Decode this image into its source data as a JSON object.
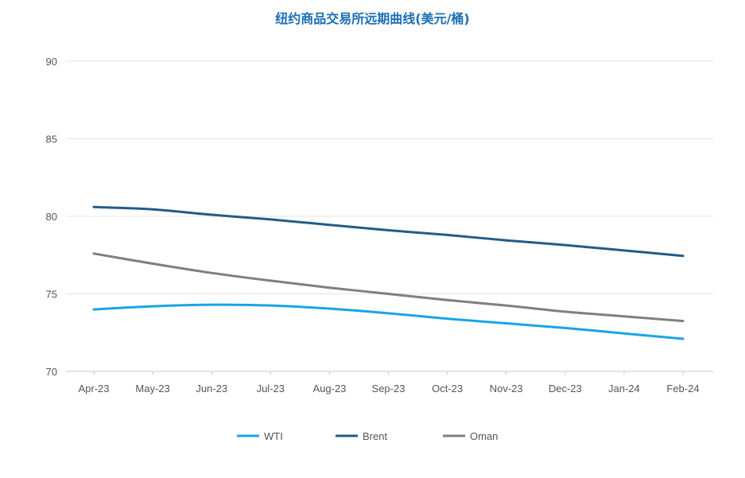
{
  "chart_data": {
    "type": "line",
    "title": "纽约商品交易所远期曲线(美元/桶)",
    "xlabel": "",
    "ylabel": "",
    "categories": [
      "Apr-23",
      "May-23",
      "Jun-23",
      "Jul-23",
      "Aug-23",
      "Sep-23",
      "Oct-23",
      "Nov-23",
      "Dec-23",
      "Jan-24",
      "Feb-24"
    ],
    "ylim": [
      70,
      90
    ],
    "yticks": [
      "70",
      "75",
      "80",
      "85",
      "90"
    ],
    "grid": true,
    "legend_position": "bottom",
    "series": [
      {
        "name": "WTI",
        "color": "#1aa3e8",
        "values": [
          74.0,
          74.2,
          74.3,
          74.25,
          74.05,
          73.75,
          73.4,
          73.1,
          72.8,
          72.45,
          72.1
        ]
      },
      {
        "name": "Brent",
        "color": "#245b88",
        "values": [
          80.6,
          80.45,
          80.1,
          79.8,
          79.45,
          79.1,
          78.8,
          78.45,
          78.15,
          77.8,
          77.45
        ]
      },
      {
        "name": "Oman",
        "color": "#7f7f7f",
        "values": [
          77.6,
          76.95,
          76.35,
          75.85,
          75.4,
          75.0,
          74.6,
          74.25,
          73.85,
          73.55,
          73.25
        ]
      }
    ]
  }
}
